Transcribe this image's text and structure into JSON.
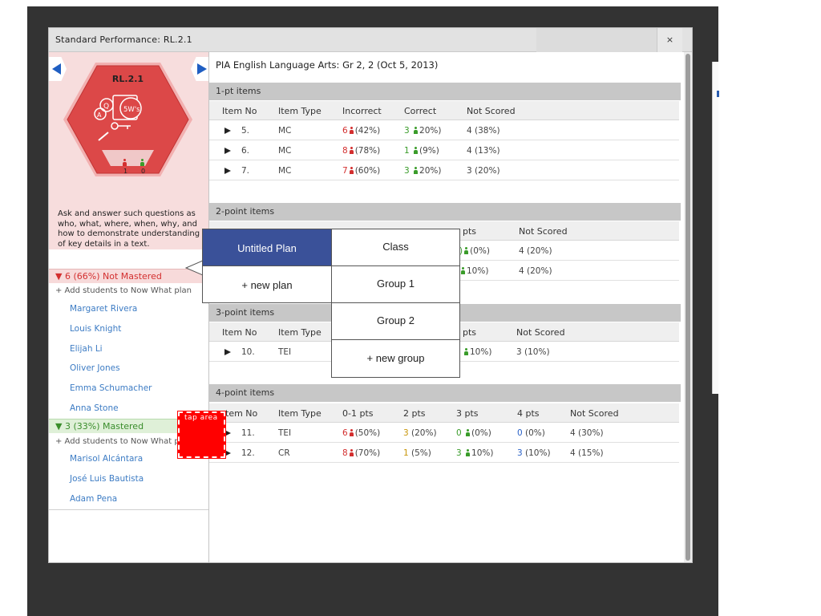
{
  "modal": {
    "title": "Standard Performance: RL.2.1",
    "close_label": "×"
  },
  "standard": {
    "code": "RL.2.1",
    "badge_text": "5W's",
    "count_not_mastered": "1",
    "count_mastered": "0",
    "description": "Ask and answer such questions as who, what, where, when, why, and how to demonstrate understanding of key details in a text.",
    "hex_color": "#e23b3b",
    "panel_color": "#f7dddd"
  },
  "groups": {
    "not_mastered": {
      "label": "▼  6 (66%) Not Mastered",
      "add_label": "+ Add students to Now What plan",
      "students": [
        "Margaret Rivera",
        "Louis Knight",
        "Elijah Li",
        "Oliver Jones",
        "Emma Schumacher",
        "Anna Stone"
      ]
    },
    "mastered": {
      "label": "▼  3 (33%) Mastered",
      "add_label": "+ Add students to Now What pla",
      "students": [
        "Marisol Alcántara",
        "José Luis Bautista",
        "Adam Pena"
      ]
    }
  },
  "main": {
    "title": "PIA English Language Arts: Gr 2, 2 (Oct 5, 2013)",
    "sections": {
      "one_pt": {
        "title": "1-pt items",
        "columns": [
          "Item No",
          "Item Type",
          "Incorrect",
          "Correct",
          "Not Scored"
        ],
        "rows": [
          {
            "no": "5.",
            "type": "MC",
            "incorrect": "6",
            "incorrect_pct": "(42%)",
            "correct": "3",
            "correct_pct": "20%)",
            "not_scored": "4 (38%)"
          },
          {
            "no": "6.",
            "type": "MC",
            "incorrect": "8",
            "incorrect_pct": "(78%)",
            "correct": "1",
            "correct_pct": "(9%)",
            "not_scored": "4 (13%)"
          },
          {
            "no": "7.",
            "type": "MC",
            "incorrect": "7",
            "incorrect_pct": "(60%)",
            "correct": "3",
            "correct_pct": "20%)",
            "not_scored": "3 (20%)"
          }
        ]
      },
      "two_pt": {
        "title": "2-point items",
        "columns": [
          "pts",
          "Not Scored"
        ],
        "rows": [
          {
            "pts_val": ")",
            "pts_pct": "(0%)",
            "not_scored": "4 (20%)"
          },
          {
            "pts_val": "",
            "pts_pct": "10%)",
            "not_scored": "4 (20%)"
          }
        ]
      },
      "three_pt": {
        "title": "3-point items",
        "columns": [
          "Item No",
          "Item Type",
          "pts",
          "Not Scored"
        ],
        "rows": [
          {
            "no": "10.",
            "type": "TEI",
            "pts_pct": "10%)",
            "not_scored": "3 (10%)"
          }
        ]
      },
      "four_pt": {
        "title": "4-point items",
        "columns": [
          "tem No",
          "Item Type",
          "0-1 pts",
          "2 pts",
          "3 pts",
          "4 pts",
          "Not Scored"
        ],
        "rows": [
          {
            "no": "11.",
            "type": "TEI",
            "p01": "6",
            "p01_pct": "(50%)",
            "p2": "3",
            "p2_pct": "(20%)",
            "p3": "0",
            "p3_pct": "(0%)",
            "p4": "0",
            "p4_pct": "(0%)",
            "not_scored": "4 (30%)"
          },
          {
            "no": "12.",
            "type": "CR",
            "p01": "8",
            "p01_pct": "(70%)",
            "p2": "1",
            "p2_pct": "(5%)",
            "p3": "3",
            "p3_pct": "10%)",
            "p4": "3",
            "p4_pct": "(10%)",
            "not_scored": "4 (15%)"
          }
        ]
      }
    }
  },
  "plan_popup": {
    "plans": [
      "Untitled Plan",
      "+ new plan"
    ],
    "groups": [
      "Class",
      "Group 1",
      "Group 2",
      "+ new group"
    ],
    "active_color": "#3a5199"
  },
  "tap_area": {
    "label": "tap area"
  }
}
